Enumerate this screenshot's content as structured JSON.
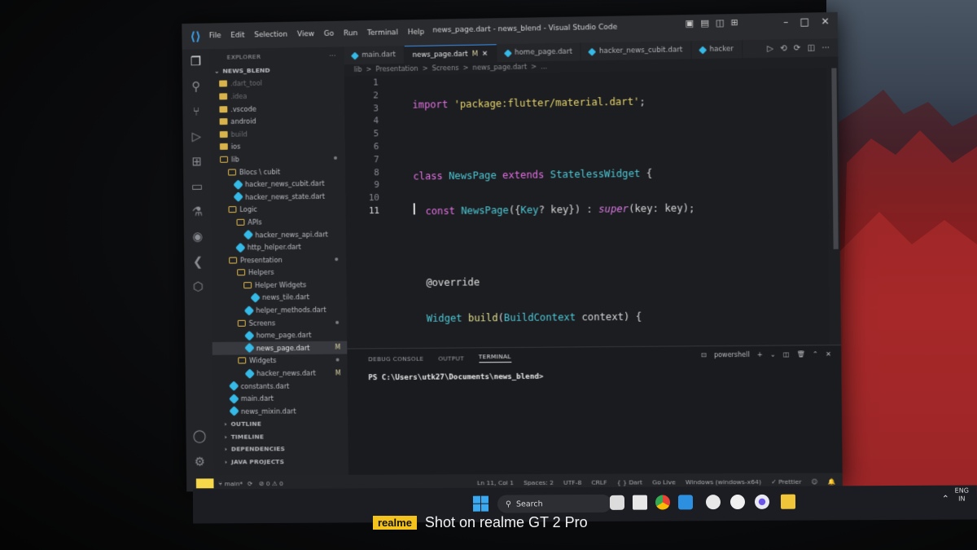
{
  "window": {
    "title": "news_page.dart - news_blend - Visual Studio Code",
    "menu": [
      "File",
      "Edit",
      "Selection",
      "View",
      "Go",
      "Run",
      "Terminal",
      "Help"
    ]
  },
  "sidebar": {
    "header": "EXPLORER",
    "project": "NEWS_BLEND",
    "tree": [
      {
        "label": ".dart_tool",
        "kind": "folder",
        "dim": true
      },
      {
        "label": ".idea",
        "kind": "folder",
        "dim": true
      },
      {
        "label": ".vscode",
        "kind": "folder"
      },
      {
        "label": "android",
        "kind": "folder"
      },
      {
        "label": "build",
        "kind": "folder",
        "dim": true
      },
      {
        "label": "ios",
        "kind": "folder"
      },
      {
        "label": "lib",
        "kind": "folder-open"
      },
      {
        "label": "Blocs \\ cubit",
        "kind": "folder-open"
      },
      {
        "label": "hacker_news_cubit.dart",
        "kind": "dart"
      },
      {
        "label": "hacker_news_state.dart",
        "kind": "dart"
      },
      {
        "label": "Logic",
        "kind": "folder-open"
      },
      {
        "label": "APIs",
        "kind": "folder-open"
      },
      {
        "label": "hacker_news_api.dart",
        "kind": "dart"
      },
      {
        "label": "http_helper.dart",
        "kind": "dart"
      },
      {
        "label": "Presentation",
        "kind": "folder-open"
      },
      {
        "label": "Helpers",
        "kind": "folder-open"
      },
      {
        "label": "Helper Widgets",
        "kind": "folder-open"
      },
      {
        "label": "news_tile.dart",
        "kind": "dart"
      },
      {
        "label": "helper_methods.dart",
        "kind": "dart"
      },
      {
        "label": "Screens",
        "kind": "folder-open"
      },
      {
        "label": "home_page.dart",
        "kind": "dart"
      },
      {
        "label": "news_page.dart",
        "kind": "dart",
        "badge": "M"
      },
      {
        "label": "Widgets",
        "kind": "folder-open"
      },
      {
        "label": "hacker_news.dart",
        "kind": "dart",
        "badge": "M"
      },
      {
        "label": "constants.dart",
        "kind": "dart"
      },
      {
        "label": "main.dart",
        "kind": "dart"
      },
      {
        "label": "news_mixin.dart",
        "kind": "dart"
      }
    ],
    "sections": [
      "OUTLINE",
      "TIMELINE",
      "DEPENDENCIES",
      "JAVA PROJECTS"
    ]
  },
  "tabs": [
    {
      "label": "main.dart"
    },
    {
      "label": "news_page.dart",
      "mod": "M"
    },
    {
      "label": "home_page.dart"
    },
    {
      "label": "hacker_news_cubit.dart"
    },
    {
      "label": "hacker"
    }
  ],
  "breadcrumb": [
    "lib",
    ">",
    "Presentation",
    ">",
    "Screens",
    ">",
    "news_page.dart",
    ">",
    "..."
  ],
  "editor": {
    "line_numbers": [
      "1",
      "2",
      "3",
      "4",
      "5",
      "6",
      "7",
      "8",
      "9",
      "10",
      "11"
    ]
  },
  "panel": {
    "tabs": [
      "DEBUG CONSOLE",
      "OUTPUT",
      "TERMINAL"
    ],
    "shell": "powershell",
    "prompt": "PS C:\\Users\\utk27\\Documents\\news_blend>"
  },
  "status": {
    "branch": "main*",
    "problems": "⊘ 0 ⚠ 0",
    "position": "Ln 11, Col 1",
    "spaces": "Spaces: 2",
    "encoding": "UTF-8",
    "eol": "CRLF",
    "language": "{ } Dart",
    "golive": "Go Live",
    "platform": "Windows (windows-x64)",
    "prettier": "✓ Prettier"
  },
  "taskbar": {
    "search": "Search",
    "lang": "ENG",
    "region": "IN"
  },
  "watermark": {
    "brand": "realme",
    "text": "Shot on realme GT 2 Pro"
  }
}
